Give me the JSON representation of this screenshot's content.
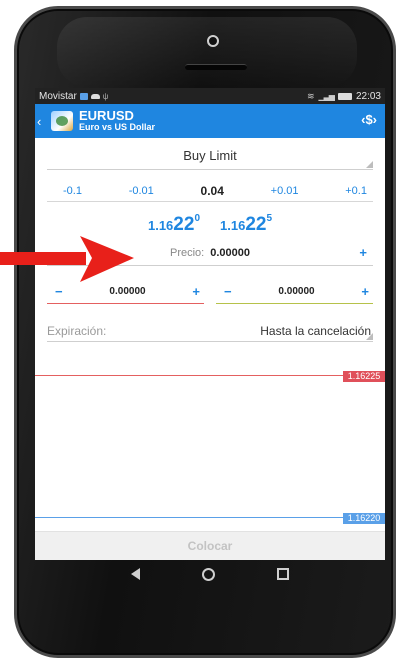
{
  "status_bar": {
    "carrier": "Movistar",
    "time": "22:03"
  },
  "app_bar": {
    "symbol": "EURUSD",
    "description": "Euro vs US Dollar",
    "back_icon": "chevron-left-icon",
    "swap_icon": "swap-icon",
    "swap_text": "‹$›"
  },
  "order": {
    "type": "Buy Limit",
    "volume": {
      "minus_big": "-0.1",
      "minus_small": "-0.01",
      "value": "0.04",
      "plus_small": "+0.01",
      "plus_big": "+0.1"
    },
    "bid": {
      "prefix": "1.16",
      "big": "22",
      "sup": "0"
    },
    "ask": {
      "prefix": "1.16",
      "big": "22",
      "sup": "5"
    },
    "price_label": "Precio:",
    "price_value": "0.00000",
    "plus": "+",
    "minus": "−",
    "stop_loss": "0.00000",
    "take_profit": "0.00000",
    "expiry_label": "Expiración:",
    "expiry_value": "Hasta la cancelación"
  },
  "chart": {
    "upper_level": "1.16225",
    "lower_level": "1.16220",
    "upper_color": "#e0505a",
    "lower_color": "#5aa0e8"
  },
  "place_button": "Colocar",
  "colors": {
    "accent": "#1f86e0",
    "arrow": "#e8201a"
  }
}
